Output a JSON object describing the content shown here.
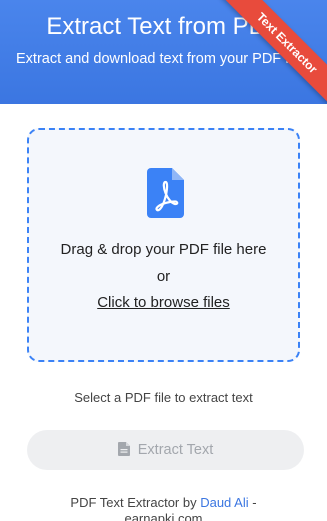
{
  "header": {
    "title": "Extract Text from PDF",
    "subtitle": "Extract and download text from your PDF files",
    "ribbon": "Text Extractor"
  },
  "dropzone": {
    "icon": "pdf-file-icon",
    "instruction": "Drag & drop your PDF file here",
    "or": "or",
    "browse_label": "Click to browse files"
  },
  "status": "Select a PDF file to extract text",
  "extract_button": {
    "icon": "document-icon",
    "label": "Extract Text"
  },
  "footer": {
    "prefix": "PDF Text Extractor by ",
    "author": "Daud Ali",
    "suffix": " - earnapki.com"
  },
  "colors": {
    "header": "#3b76e1",
    "ribbon": "#e84b3c",
    "dropzone_border": "#3b82f6",
    "dropzone_bg": "#f4f7fc",
    "button_bg": "#eeeff1",
    "link": "#3b76e1"
  }
}
